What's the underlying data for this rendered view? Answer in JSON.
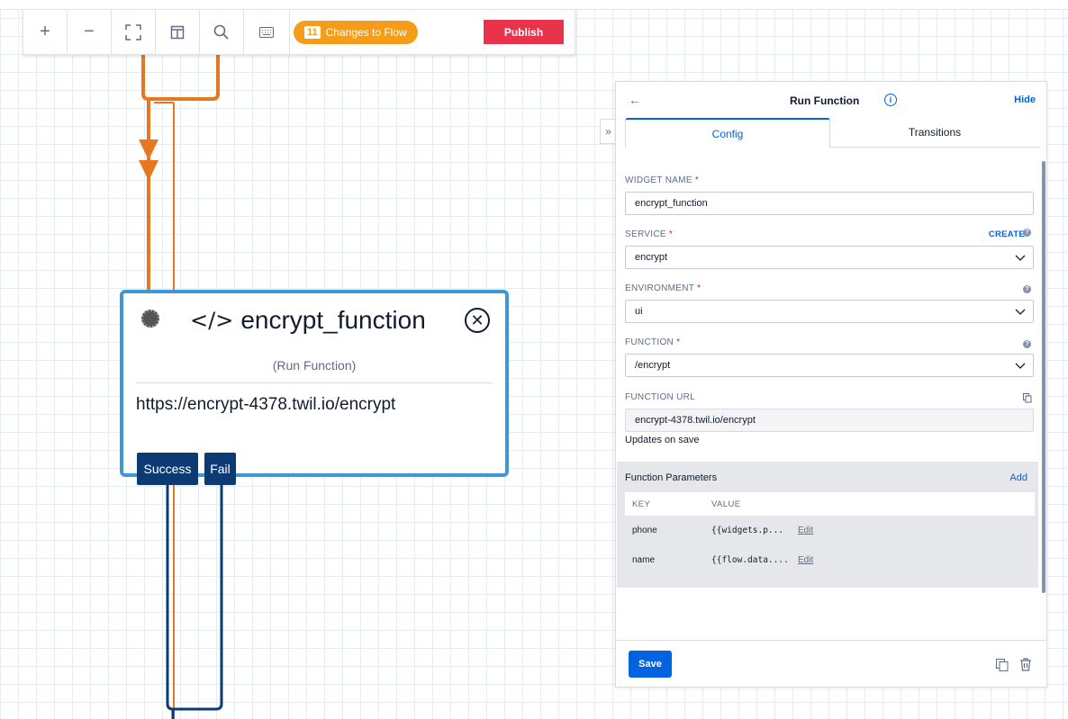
{
  "toolbar": {
    "zoom_in_label": "+",
    "zoom_out_label": "−",
    "changes_count": "11",
    "changes_label": "Changes to Flow",
    "publish_label": "Publish",
    "changes_color": "#f59c1a",
    "publish_color": "#e8334a"
  },
  "widget": {
    "code_icon": "</>",
    "name": "encrypt_function",
    "type": "(Run Function)",
    "url": "https://encrypt-4378.twil.io/encrypt",
    "transitions": [
      "Success",
      "Fail"
    ],
    "border_color": "#3c98d6"
  },
  "panel": {
    "back": "←",
    "title": "Run Function",
    "hide": "Hide",
    "tabs": [
      "Config",
      "Transitions"
    ],
    "widget_name_label": "WIDGET NAME",
    "widget_name_value": "encrypt_function",
    "service_label": "SERVICE",
    "create_label": "CREATE",
    "service_value": "encrypt",
    "environment_label": "ENVIRONMENT",
    "environment_value": "ui",
    "function_label": "FUNCTION",
    "function_value": "/encrypt",
    "function_url_label": "FUNCTION URL",
    "function_url_value": "encrypt-4378.twil.io/encrypt",
    "updates_note": "Updates on save",
    "params_heading": "Function Parameters",
    "params_add": "Add",
    "params_columns": [
      "KEY",
      "VALUE"
    ],
    "params": [
      {
        "key": "phone",
        "value": "{{widgets.p...",
        "edit": "Edit"
      },
      {
        "key": "name",
        "value": "{{flow.data....",
        "edit": "Edit"
      }
    ],
    "save_label": "Save",
    "accent_color": "#0263e0"
  }
}
